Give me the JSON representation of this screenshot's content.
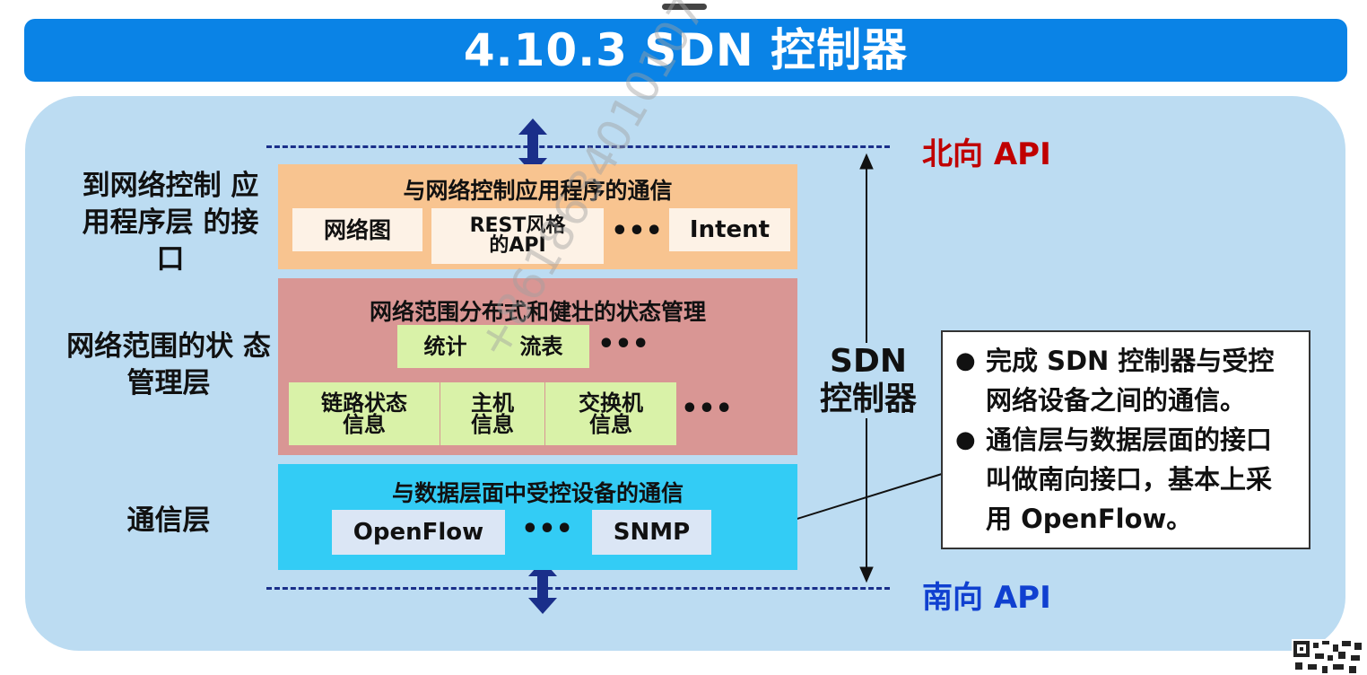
{
  "title": "4.10.3  SDN 控制器",
  "north_api": "北向 API",
  "south_api": "南向 API",
  "sdn_controller_label": "SDN 控制器",
  "left_labels": {
    "app_interface": "到网络控制 应用程序层 的接口",
    "state_mgmt": "网络范围的状 态管理层",
    "communication": "通信层"
  },
  "app_layer": {
    "title": "与网络控制应用程序的通信",
    "items": [
      "网络图",
      "REST风格 的API",
      "•••",
      "Intent"
    ]
  },
  "state_layer": {
    "title": "网络范围分布式和健壮的状态管理",
    "row1": [
      "统计",
      "流表",
      "•••"
    ],
    "row2": [
      "链路状态 信息",
      "主机 信息",
      "交换机 信息",
      "•••"
    ]
  },
  "comm_layer": {
    "title": "与数据层面中受控设备的通信",
    "items": [
      "OpenFlow",
      "•••",
      "SNMP"
    ]
  },
  "note": {
    "items": [
      "完成 SDN 控制器与受控网络设备之间的通信。",
      "通信层与数据层面的接口叫做南向接口，基本上采用 OpenFlow。"
    ]
  },
  "watermark": "+8618634010107",
  "colors": {
    "title_bar": "#0a83e6",
    "panel": "#bcdcf2",
    "app_layer": "#f8c490",
    "state_layer": "#d99694",
    "comm_layer": "#33ccf5",
    "north_api": "#c00000",
    "south_api": "#1040d0",
    "arrow": "#1a2f8a"
  }
}
